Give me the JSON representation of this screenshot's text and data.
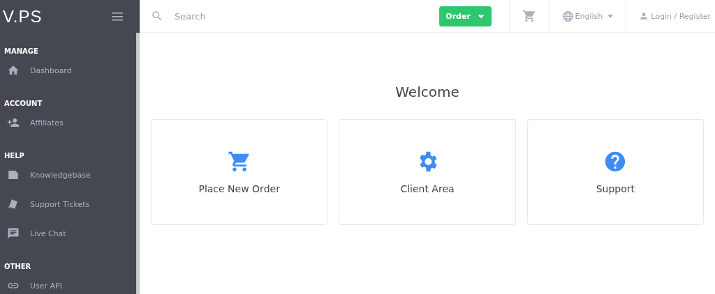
{
  "logo": "V.PS",
  "sidebar": {
    "sections": [
      {
        "title": "MANAGE",
        "items": [
          {
            "label": "Dashboard",
            "kind": "home"
          }
        ]
      },
      {
        "title": "ACCOUNT",
        "items": [
          {
            "label": "Affiliates",
            "kind": "people"
          }
        ]
      },
      {
        "title": "HELP",
        "items": [
          {
            "label": "Knowledgebase",
            "kind": "book"
          },
          {
            "label": "Support Tickets",
            "kind": "tickets"
          },
          {
            "label": "Live Chat",
            "kind": "chat"
          }
        ]
      },
      {
        "title": "OTHER",
        "items": [
          {
            "label": "User API",
            "kind": "link"
          }
        ]
      }
    ]
  },
  "topbar": {
    "search": {
      "placeholder": "Search"
    },
    "order_button": "Order",
    "language": "English",
    "login": "Login / Register"
  },
  "main": {
    "title": "Welcome",
    "cards": [
      {
        "label": "Place New Order",
        "kind": "cart"
      },
      {
        "label": "Client Area",
        "kind": "gear"
      },
      {
        "label": "Support",
        "kind": "help"
      }
    ]
  }
}
